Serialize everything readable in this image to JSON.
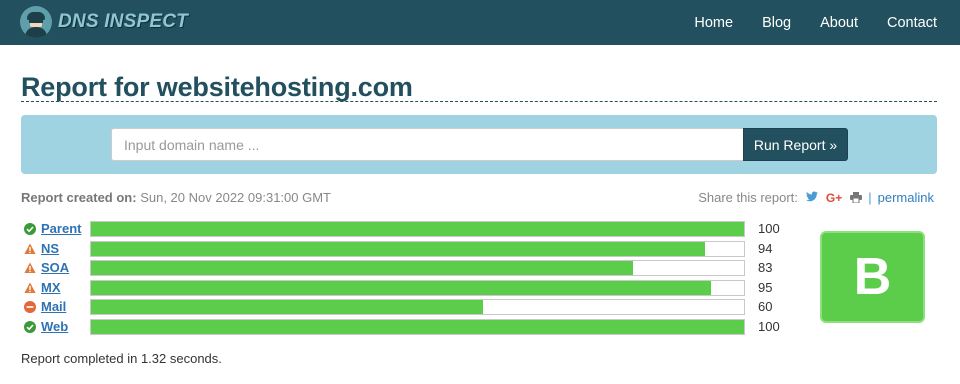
{
  "brand": {
    "name": "DNS INSPECT",
    "logo_icon": "detective-icon"
  },
  "nav": {
    "items": [
      {
        "label": "Home"
      },
      {
        "label": "Blog"
      },
      {
        "label": "About"
      },
      {
        "label": "Contact"
      }
    ]
  },
  "page": {
    "title": "Report for websitehosting.com"
  },
  "search": {
    "value": "",
    "placeholder": "Input domain name ...",
    "button_label": "Run Report »"
  },
  "report": {
    "created_label": "Report created on:",
    "created_value": "Sun, 20 Nov 2022 09:31:00 GMT",
    "grade": "B",
    "completed_text": "Report completed in 1.32 seconds."
  },
  "share": {
    "label": "Share this report:",
    "separator": "|",
    "permalink": "permalink"
  },
  "checks": [
    {
      "label": "Parent",
      "score": 100,
      "status": "pass"
    },
    {
      "label": "NS",
      "score": 94,
      "status": "warning"
    },
    {
      "label": "SOA",
      "score": 83,
      "status": "warning"
    },
    {
      "label": "MX",
      "score": 95,
      "status": "warning"
    },
    {
      "label": "Mail",
      "score": 60,
      "status": "error"
    },
    {
      "label": "Web",
      "score": 100,
      "status": "pass"
    }
  ],
  "colors": {
    "navbar": "#22505f",
    "accent": "#2f72b3",
    "bar_fill": "#5ccd4a",
    "pass": "#3a9a3a",
    "warning": "#e07a3a",
    "error": "#e0683a",
    "search_panel": "#9fd3e2"
  }
}
